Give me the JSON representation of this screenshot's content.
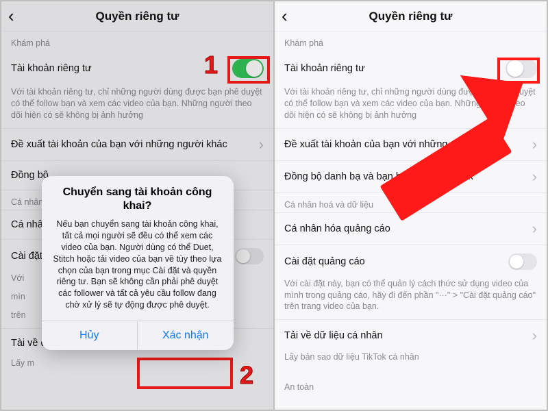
{
  "header": {
    "title": "Quyền riêng tư"
  },
  "sections": {
    "discover": "Khám phá",
    "personal": "Cá nhân hoá và dữ liệu",
    "dataShort": "Cá nhân",
    "safety": "An toàn"
  },
  "private": {
    "label": "Tài khoản riêng tư",
    "desc": "Với tài khoản riêng tư, chỉ những người dùng được bạn phê duyệt có thể follow bạn và xem các video của bạn. Những người theo dõi hiện có sẽ không bị ảnh hưởng"
  },
  "rows": {
    "suggest": "Đề xuất tài khoản của bạn với những người khác",
    "syncShort": "Đồng bộ",
    "syncFull": "Đồng bộ danh bạ và bạn bè trên Facebook",
    "adsPersonal": "Cá nhân hóa quảng cáo",
    "adsPersonalShort": "Cá nhân",
    "adsSettings": "Cài đặt quảng cáo",
    "adsSettingsShort": "Cài đặt",
    "adsDesc": "Với cài đặt này, bạn có thể quản lý cách thức sử dụng video của mình trong quảng cáo, hãy đi đến phần \"···\" > \"Cài đặt quảng cáo\" trên trang video của bạn.",
    "adsDescShort": "Với ",
    "adsDescShort2": "mìn",
    "adsDescShort3": "trên",
    "download": "Tải về dữ liệu cá nhân",
    "downloadShort": "Tài về d",
    "downloadSub": "Lấy bản sao dữ liệu TikTok cá nhân",
    "downloadSubShort": "Lấy m"
  },
  "modal": {
    "title": "Chuyển sang tài khoản công khai?",
    "body": "Nếu bạn chuyển sang tài khoản công khai, tất cả mọi người sẽ đều có thể xem các video của bạn. Người dùng có thể Duet, Stitch hoặc tải video của bạn về tùy theo lựa chọn của bạn trong mục Cài đặt và quyền riêng tư. Bạn sẽ không cần phải phê duyệt các follower và tất cả yêu cầu follow đang chờ xử lý sẽ tự động được phê duyệt.",
    "cancel": "Hủy",
    "confirm": "Xác nhận"
  },
  "annotations": {
    "one": "1",
    "two": "2"
  }
}
